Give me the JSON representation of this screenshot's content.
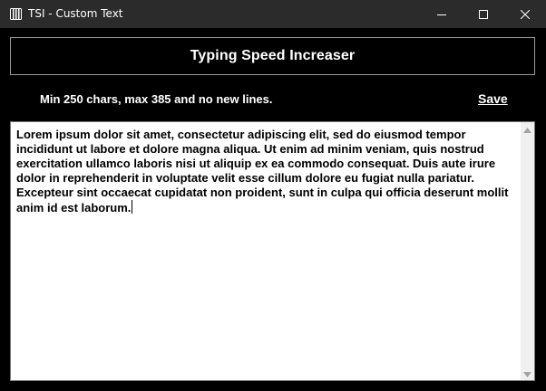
{
  "window": {
    "title": "TSI - Custom Text",
    "app_icon": "tsi-app-icon",
    "controls": {
      "minimize_icon": "minimize-icon",
      "maximize_icon": "maximize-icon",
      "close_icon": "close-icon"
    }
  },
  "header": {
    "title": "Typing Speed Increaser"
  },
  "instructions": {
    "text": "Min 250 chars, max 385 and no new lines."
  },
  "actions": {
    "save_label": "Save"
  },
  "editor": {
    "value": "Lorem ipsum dolor sit amet, consectetur adipiscing elit, sed do eiusmod tempor incididunt ut labore et dolore magna aliqua. Ut enim ad minim veniam, quis nostrud exercitation ullamco laboris nisi ut aliquip ex ea commodo consequat. Duis aute irure dolor in reprehenderit in voluptate velit esse cillum dolore eu fugiat nulla pariatur. Excepteur sint occaecat cupidatat non proident, sunt in culpa qui officia deserunt mollit anim id est laborum.",
    "scroll_up_icon": "scroll-up-arrow-icon",
    "scroll_down_icon": "scroll-down-arrow-icon"
  },
  "colors": {
    "titlebar_bg": "#2b2b2b",
    "content_bg": "#000000",
    "text": "#ffffff",
    "editor_bg": "#ffffff",
    "header_border": "#9a9a9a"
  }
}
